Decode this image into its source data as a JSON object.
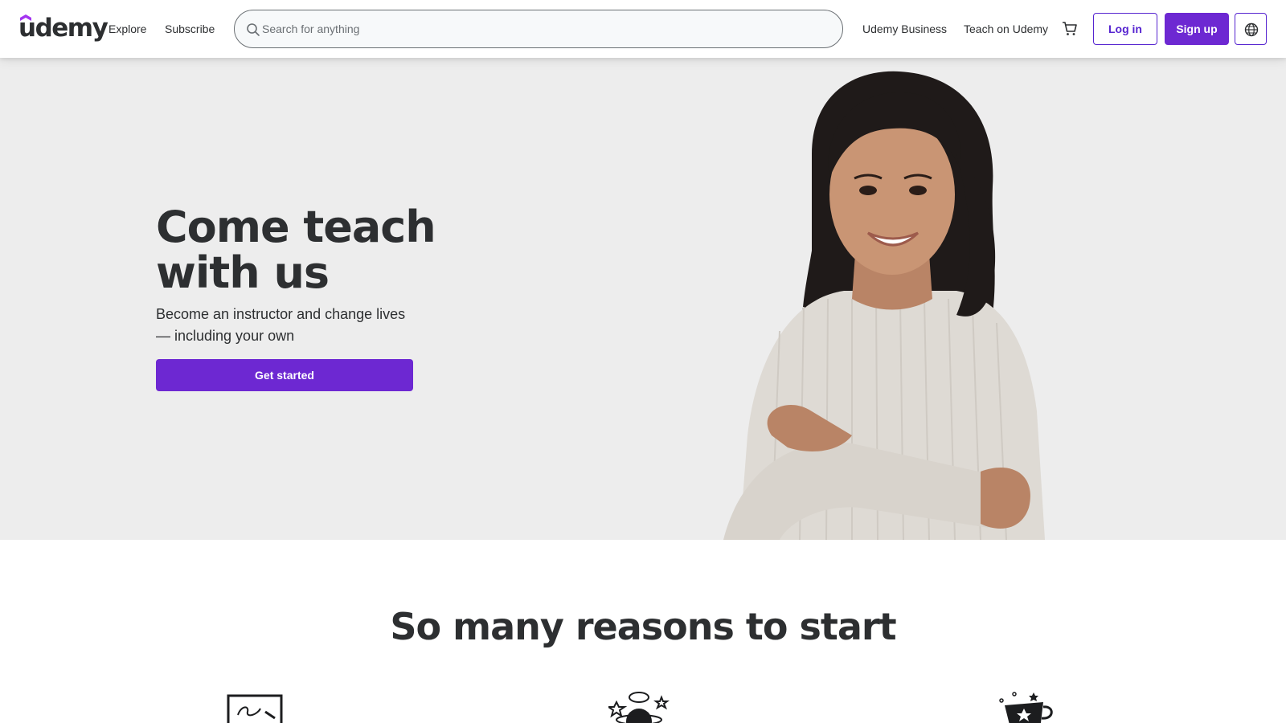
{
  "header": {
    "logo_text": "udemy",
    "explore_label": "Explore",
    "subscribe_label": "Subscribe",
    "search_placeholder": "Search for anything",
    "udemy_business_label": "Udemy Business",
    "teach_label": "Teach on Udemy",
    "login_label": "Log in",
    "signup_label": "Sign up",
    "icons": [
      "search-icon",
      "cart-icon",
      "globe-icon"
    ]
  },
  "hero": {
    "title": "Come teach with us",
    "subtitle": "Become an instructor and change lives — including your own",
    "cta_label": "Get started"
  },
  "reasons": {
    "title": "So many reasons to start",
    "illustrations": [
      "teaching-board-illustration",
      "planet-stars-illustration",
      "trophy-cup-illustration"
    ]
  },
  "colors": {
    "brand_purple": "#6d28d2",
    "outline_purple": "#5624d0",
    "hero_bg": "#ededed",
    "text_dark": "#2d2f31"
  }
}
